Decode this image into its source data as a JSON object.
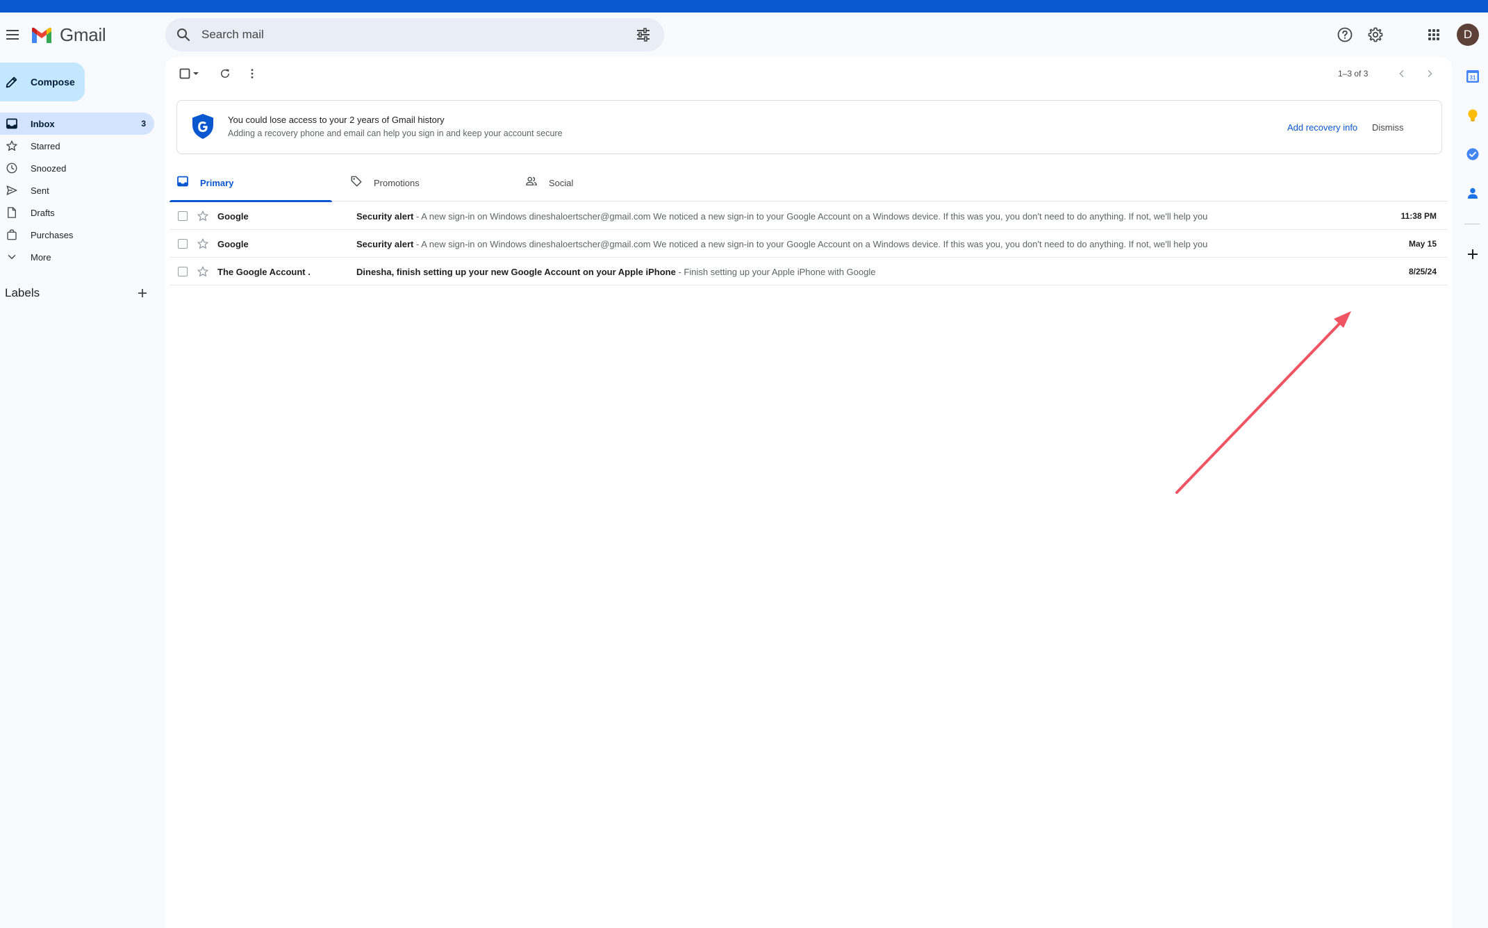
{
  "app": {
    "name": "Gmail"
  },
  "search": {
    "placeholder": "Search mail",
    "value": ""
  },
  "account": {
    "initial": "D"
  },
  "compose": {
    "label": "Compose"
  },
  "nav": {
    "inbox": {
      "label": "Inbox",
      "count": "3"
    },
    "starred": {
      "label": "Starred"
    },
    "snoozed": {
      "label": "Snoozed"
    },
    "sent": {
      "label": "Sent"
    },
    "drafts": {
      "label": "Drafts"
    },
    "purchases": {
      "label": "Purchases"
    },
    "more": {
      "label": "More"
    }
  },
  "labels": {
    "title": "Labels"
  },
  "toolbar": {
    "pager": "1–3 of 3"
  },
  "banner": {
    "title": "You could lose access to your 2 years of Gmail history",
    "subtitle": "Adding a recovery phone and email can help you sign in and keep your account secure",
    "action": "Add recovery info",
    "dismiss": "Dismiss"
  },
  "tabs": {
    "primary": "Primary",
    "promotions": "Promotions",
    "social": "Social"
  },
  "emails": [
    {
      "sender": "Google",
      "subject": "Security alert",
      "snippet": " - A new sign-in on Windows dineshaloertscher@gmail.com We noticed a new sign-in to your Google Account on a Windows device. If this was you, you don't need to do anything. If not, we'll help you",
      "date": "11:38 PM"
    },
    {
      "sender": "Google",
      "subject": "Security alert",
      "snippet": " - A new sign-in on Windows dineshaloertscher@gmail.com We noticed a new sign-in to your Google Account on a Windows device. If this was you, you don't need to do anything. If not, we'll help you",
      "date": "May 15"
    },
    {
      "sender": "The Google Account .",
      "subject": "Dinesha, finish setting up your new Google Account on your Apple iPhone",
      "snippet": " - Finish setting up your Apple iPhone with Google",
      "date": "8/25/24"
    }
  ],
  "colors": {
    "accent": "#0b57d0",
    "compose_bg": "#c2e7ff",
    "nav_active": "#d3e3fd",
    "annotation_arrow": "#f05463"
  }
}
